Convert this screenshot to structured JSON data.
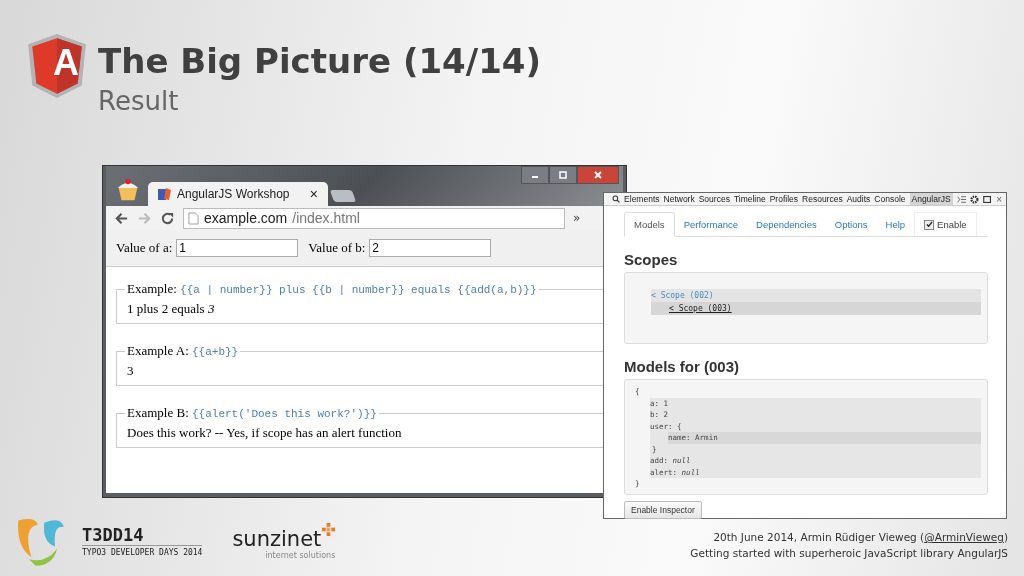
{
  "slide": {
    "logo_letter": "A",
    "title": "The Big Picture (14/14)",
    "subtitle": "Result"
  },
  "browser": {
    "tab": {
      "title": "AngularJS Workshop",
      "close": "×"
    },
    "url_host": "example.com",
    "url_path": "/index.html",
    "overflow": "»",
    "inputs": [
      {
        "label": "Value of a:",
        "value": "1"
      },
      {
        "label": "Value of b:",
        "value": "2"
      }
    ],
    "examples": [
      {
        "legend": "Example:",
        "code": "{{a | number}} plus {{b | number}} equals {{add(a,b)}}",
        "output": "1 plus 2 equals *3*"
      },
      {
        "legend": "Example A:",
        "code": "{{a+b}}",
        "output": "3"
      },
      {
        "legend": "Example B:",
        "code": "{{alert('Does this work?')}}",
        "output": "Does this work? -- Yes, if scope has an alert function"
      }
    ]
  },
  "devtools": {
    "panels": [
      {
        "label": "Elements",
        "selected": false
      },
      {
        "label": "Network",
        "selected": false
      },
      {
        "label": "Sources",
        "selected": false
      },
      {
        "label": "Timeline",
        "selected": false
      },
      {
        "label": "Profiles",
        "selected": false
      },
      {
        "label": "Resources",
        "selected": false
      },
      {
        "label": "Audits",
        "selected": false
      },
      {
        "label": "Console",
        "selected": false
      },
      {
        "label": "AngularJS",
        "selected": true
      }
    ],
    "close": "×",
    "tabs": [
      {
        "label": "Models",
        "selected": true
      },
      {
        "label": "Performance",
        "selected": false
      },
      {
        "label": "Dependencies",
        "selected": false
      },
      {
        "label": "Options",
        "selected": false
      },
      {
        "label": "Help",
        "selected": false
      }
    ],
    "enable": {
      "label": "Enable",
      "checked": true
    },
    "scopes_heading": "Scopes",
    "scopes": [
      {
        "label": "< Scope (002)",
        "selected": false,
        "children": [
          {
            "label": "< Scope (003)",
            "selected": true
          }
        ]
      }
    ],
    "models_heading": "Models for (003)",
    "models": {
      "open": "{",
      "close": "}",
      "entries": [
        {
          "text": "a: 1"
        },
        {
          "text": "b: 2"
        },
        {
          "text": "user:  {",
          "close": "}",
          "children": [
            {
              "text": "name: Armin"
            }
          ]
        },
        {
          "text": "add: *null*"
        },
        {
          "text": "alert: *null*"
        }
      ]
    },
    "inspector_button": "Enable Inspector"
  },
  "footer": {
    "event": "T3DD14",
    "event_sub": "TYPO3 DEVELOPER DAYS 2014",
    "sponsor": "sunzinet",
    "sponsor_sub": "internet solutions",
    "credit_prefix": "20th June 2014, Armin Rüdiger Vieweg (",
    "credit_link": "@ArminVieweg",
    "credit_suffix": ")",
    "talk": "Getting started with superheroic JavaScript library AngularJS"
  }
}
